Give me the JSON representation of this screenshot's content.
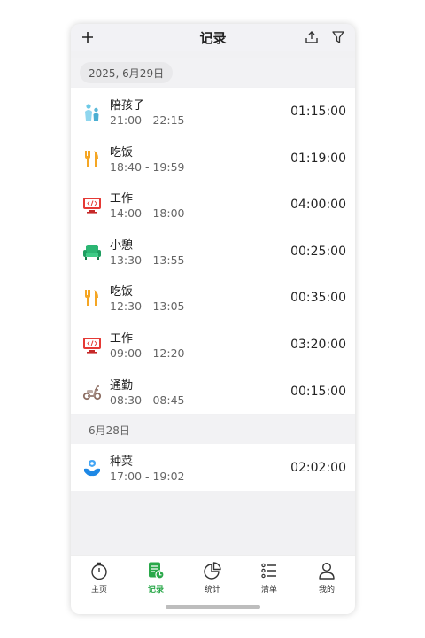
{
  "header": {
    "title": "记录",
    "add_icon": "plus-icon",
    "export_icon": "share-upload-icon",
    "filter_icon": "filter-funnel-icon"
  },
  "groups": [
    {
      "date": "2025, 6月29日",
      "items": [
        {
          "name": "陪孩子",
          "time": "21:00 - 22:15",
          "duration": "01:15:00",
          "icon": "parent-child-icon"
        },
        {
          "name": "吃饭",
          "time": "18:40 - 19:59",
          "duration": "01:19:00",
          "icon": "fork-knife-icon"
        },
        {
          "name": "工作",
          "time": "14:00 - 18:00",
          "duration": "04:00:00",
          "icon": "monitor-code-icon"
        },
        {
          "name": "小憩",
          "time": "13:30 - 13:55",
          "duration": "00:25:00",
          "icon": "armchair-icon"
        },
        {
          "name": "吃饭",
          "time": "12:30 - 13:05",
          "duration": "00:35:00",
          "icon": "fork-knife-icon"
        },
        {
          "name": "工作",
          "time": "09:00 - 12:20",
          "duration": "03:20:00",
          "icon": "monitor-code-icon"
        },
        {
          "name": "通勤",
          "time": "08:30 - 08:45",
          "duration": "00:15:00",
          "icon": "scooter-icon"
        }
      ]
    },
    {
      "date": "6月28日",
      "items": [
        {
          "name": "种菜",
          "time": "17:00 - 19:02",
          "duration": "02:02:00",
          "icon": "plant-hand-icon"
        }
      ]
    }
  ],
  "tabs": [
    {
      "label": "主页",
      "icon": "stopwatch-icon",
      "active": false
    },
    {
      "label": "记录",
      "icon": "record-doc-icon",
      "active": true
    },
    {
      "label": "统计",
      "icon": "pie-chart-icon",
      "active": false
    },
    {
      "label": "清单",
      "icon": "checklist-icon",
      "active": false
    },
    {
      "label": "我的",
      "icon": "person-icon",
      "active": false
    }
  ],
  "colors": {
    "accent": "#2aa84a",
    "background": "#f1f1f3"
  }
}
